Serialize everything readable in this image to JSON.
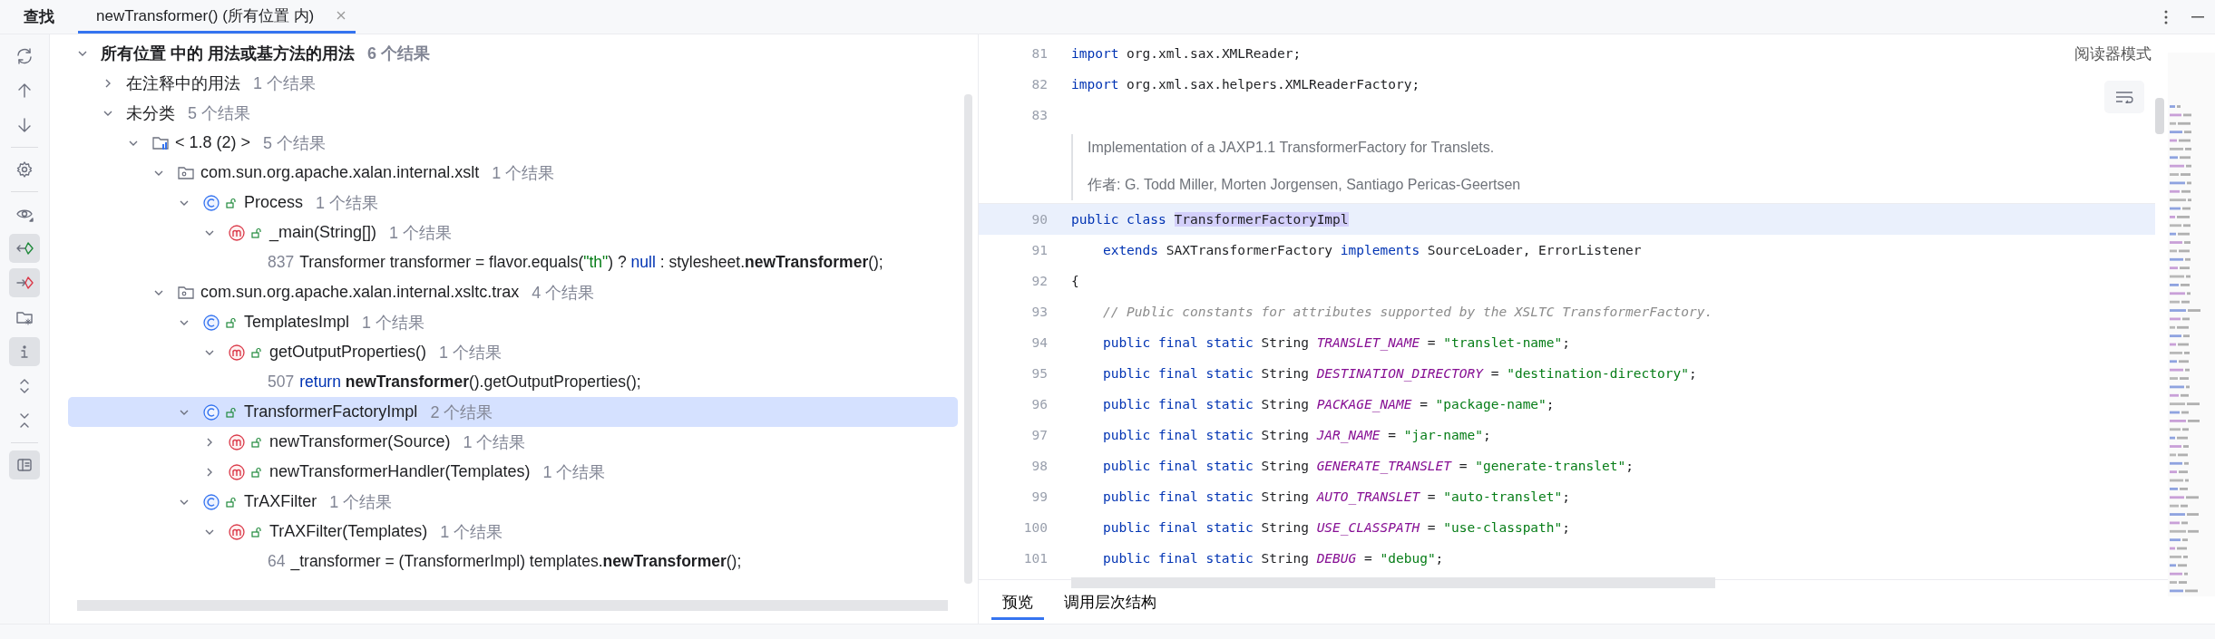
{
  "header": {
    "title": "查找",
    "tabs": [
      {
        "label": "newTransformer() (所有位置 内)",
        "selected": true,
        "closable": true
      }
    ]
  },
  "toolbar": [
    {
      "kind": "refresh",
      "on": false
    },
    {
      "kind": "up",
      "on": false
    },
    {
      "kind": "down",
      "on": false
    },
    {
      "kind": "settings",
      "on": false
    },
    {
      "kind": "eye",
      "on": false
    },
    {
      "kind": "import",
      "on": true
    },
    {
      "kind": "export",
      "on": true
    },
    {
      "kind": "folder",
      "on": false
    },
    {
      "kind": "info",
      "on": true
    },
    {
      "kind": "expand",
      "on": false
    },
    {
      "kind": "collapse",
      "on": false
    },
    {
      "kind": "preview",
      "on": true
    }
  ],
  "tree": {
    "kind": "root",
    "label": "所有位置 中的 用法或基方法的用法",
    "count": "6 个结果",
    "expanded": true,
    "selected": false,
    "children": [
      {
        "kind": "group",
        "label": "在注释中的用法",
        "count": "1 个结果",
        "expanded": false,
        "selected": false
      },
      {
        "kind": "group",
        "label": "未分类",
        "count": "5 个结果",
        "expanded": true,
        "selected": false,
        "children": [
          {
            "kind": "module",
            "label": "< 1.8 (2) >",
            "count": "5 个结果",
            "expanded": true,
            "selected": false,
            "children": [
              {
                "kind": "package",
                "label": "com.sun.org.apache.xalan.internal.xslt",
                "count": "1 个结果",
                "expanded": true,
                "selected": false,
                "children": [
                  {
                    "kind": "class",
                    "label": "Process",
                    "count": "1 个结果",
                    "expanded": true,
                    "selected": false,
                    "children": [
                      {
                        "kind": "method",
                        "label": "_main(String[])",
                        "count": "1 个结果",
                        "expanded": true,
                        "selected": false,
                        "children": [
                          {
                            "kind": "usage",
                            "line": "837",
                            "selected": false,
                            "segments": [
                              {
                                "kind": "plain",
                                "t": "Transformer transformer = flavor.equals("
                              },
                              {
                                "kind": "str",
                                "t": "\"th\""
                              },
                              {
                                "kind": "plain",
                                "t": ") ? "
                              },
                              {
                                "kind": "kw",
                                "t": "null"
                              },
                              {
                                "kind": "plain",
                                "t": " : stylesheet."
                              },
                              {
                                "kind": "bold",
                                "t": "newTransformer"
                              },
                              {
                                "kind": "plain",
                                "t": "();"
                              }
                            ]
                          }
                        ]
                      }
                    ]
                  }
                ]
              },
              {
                "kind": "package",
                "label": "com.sun.org.apache.xalan.internal.xsltc.trax",
                "count": "4 个结果",
                "expanded": true,
                "selected": false,
                "children": [
                  {
                    "kind": "class",
                    "label": "TemplatesImpl",
                    "count": "1 个结果",
                    "expanded": true,
                    "selected": false,
                    "children": [
                      {
                        "kind": "method",
                        "label": "getOutputProperties()",
                        "count": "1 个结果",
                        "expanded": true,
                        "selected": false,
                        "children": [
                          {
                            "kind": "usage",
                            "line": "507",
                            "selected": false,
                            "segments": [
                              {
                                "kind": "kw",
                                "t": "return "
                              },
                              {
                                "kind": "bold",
                                "t": "newTransformer"
                              },
                              {
                                "kind": "plain",
                                "t": "().getOutputProperties();"
                              }
                            ]
                          }
                        ]
                      }
                    ]
                  },
                  {
                    "kind": "class",
                    "label": "TransformerFactoryImpl",
                    "count": "2 个结果",
                    "expanded": true,
                    "selected": true,
                    "children": [
                      {
                        "kind": "method",
                        "label": "newTransformer(Source)",
                        "count": "1 个结果",
                        "expanded": false,
                        "selected": false
                      },
                      {
                        "kind": "method",
                        "label": "newTransformerHandler(Templates)",
                        "count": "1 个结果",
                        "expanded": false,
                        "selected": false
                      }
                    ]
                  },
                  {
                    "kind": "class",
                    "label": "TrAXFilter",
                    "count": "1 个结果",
                    "expanded": true,
                    "selected": false,
                    "children": [
                      {
                        "kind": "method",
                        "label": "TrAXFilter(Templates)",
                        "count": "1 个结果",
                        "expanded": true,
                        "selected": false,
                        "children": [
                          {
                            "kind": "usage",
                            "line": "64",
                            "selected": false,
                            "segments": [
                              {
                                "kind": "plain",
                                "t": "_transformer = (TransformerImpl) templates."
                              },
                              {
                                "kind": "bold",
                                "t": "newTransformer"
                              },
                              {
                                "kind": "plain",
                                "t": "();"
                              }
                            ]
                          }
                        ]
                      }
                    ]
                  }
                ]
              }
            ]
          }
        ]
      }
    ]
  },
  "editor": {
    "reader_mode": "阅读器模式",
    "lines": [
      {
        "kind": "code",
        "no": "81",
        "current": false,
        "segments": [
          {
            "kind": "kw",
            "t": "import"
          },
          {
            "kind": "plain",
            "t": " org.xml.sax.XMLReader;"
          }
        ]
      },
      {
        "kind": "code",
        "no": "82",
        "current": false,
        "segments": [
          {
            "kind": "kw",
            "t": "import"
          },
          {
            "kind": "plain",
            "t": " org.xml.sax.helpers.XMLReaderFactory;"
          }
        ]
      },
      {
        "kind": "code",
        "no": "83",
        "current": false
      },
      {
        "kind": "doc",
        "text": "Implementation of a JAXP1.1 TransformerFactory for Translets.",
        "author": "作者: G. Todd Miller, Morten Jorgensen, Santiago Pericas-Geertsen"
      },
      {
        "kind": "code",
        "no": "90",
        "current": true,
        "segments": [
          {
            "kind": "kw",
            "t": "public class "
          },
          {
            "kind": "mark",
            "t": "TransformerFactoryImpl"
          }
        ]
      },
      {
        "kind": "code",
        "no": "91",
        "current": false,
        "segments": [
          {
            "kind": "kw",
            "t": "    extends"
          },
          {
            "kind": "plain",
            "t": " SAXTransformerFactory "
          },
          {
            "kind": "kw",
            "t": "implements"
          },
          {
            "kind": "plain",
            "t": " SourceLoader, ErrorListener"
          }
        ]
      },
      {
        "kind": "code",
        "no": "92",
        "current": false,
        "segments": [
          {
            "kind": "plain",
            "t": "{"
          }
        ]
      },
      {
        "kind": "code",
        "no": "93",
        "current": false,
        "segments": [
          {
            "kind": "comment",
            "t": "    // Public constants for attributes supported by the XSLTC TransformerFactory."
          }
        ]
      },
      {
        "kind": "code",
        "no": "94",
        "current": false,
        "segments": [
          {
            "kind": "kw",
            "t": "    public final static"
          },
          {
            "kind": "plain",
            "t": " String "
          },
          {
            "kind": "const",
            "t": "TRANSLET_NAME"
          },
          {
            "kind": "plain",
            "t": " = "
          },
          {
            "kind": "str",
            "t": "\"translet-name\""
          },
          {
            "kind": "plain",
            "t": ";"
          }
        ]
      },
      {
        "kind": "code",
        "no": "95",
        "current": false,
        "segments": [
          {
            "kind": "kw",
            "t": "    public final static"
          },
          {
            "kind": "plain",
            "t": " String "
          },
          {
            "kind": "const",
            "t": "DESTINATION_DIRECTORY"
          },
          {
            "kind": "plain",
            "t": " = "
          },
          {
            "kind": "str",
            "t": "\"destination-directory\""
          },
          {
            "kind": "plain",
            "t": ";"
          }
        ]
      },
      {
        "kind": "code",
        "no": "96",
        "current": false,
        "segments": [
          {
            "kind": "kw",
            "t": "    public final static"
          },
          {
            "kind": "plain",
            "t": " String "
          },
          {
            "kind": "const",
            "t": "PACKAGE_NAME"
          },
          {
            "kind": "plain",
            "t": " = "
          },
          {
            "kind": "str",
            "t": "\"package-name\""
          },
          {
            "kind": "plain",
            "t": ";"
          }
        ]
      },
      {
        "kind": "code",
        "no": "97",
        "current": false,
        "segments": [
          {
            "kind": "kw",
            "t": "    public final static"
          },
          {
            "kind": "plain",
            "t": " String "
          },
          {
            "kind": "const",
            "t": "JAR_NAME"
          },
          {
            "kind": "plain",
            "t": " = "
          },
          {
            "kind": "str",
            "t": "\"jar-name\""
          },
          {
            "kind": "plain",
            "t": ";"
          }
        ]
      },
      {
        "kind": "code",
        "no": "98",
        "current": false,
        "segments": [
          {
            "kind": "kw",
            "t": "    public final static"
          },
          {
            "kind": "plain",
            "t": " String "
          },
          {
            "kind": "const",
            "t": "GENERATE_TRANSLET"
          },
          {
            "kind": "plain",
            "t": " = "
          },
          {
            "kind": "str",
            "t": "\"generate-translet\""
          },
          {
            "kind": "plain",
            "t": ";"
          }
        ]
      },
      {
        "kind": "code",
        "no": "99",
        "current": false,
        "segments": [
          {
            "kind": "kw",
            "t": "    public final static"
          },
          {
            "kind": "plain",
            "t": " String "
          },
          {
            "kind": "const",
            "t": "AUTO_TRANSLET"
          },
          {
            "kind": "plain",
            "t": " = "
          },
          {
            "kind": "str",
            "t": "\"auto-translet\""
          },
          {
            "kind": "plain",
            "t": ";"
          }
        ]
      },
      {
        "kind": "code",
        "no": "100",
        "current": false,
        "segments": [
          {
            "kind": "kw",
            "t": "    public final static"
          },
          {
            "kind": "plain",
            "t": " String "
          },
          {
            "kind": "const",
            "t": "USE_CLASSPATH"
          },
          {
            "kind": "plain",
            "t": " = "
          },
          {
            "kind": "str",
            "t": "\"use-classpath\""
          },
          {
            "kind": "plain",
            "t": ";"
          }
        ]
      },
      {
        "kind": "code",
        "no": "101",
        "current": false,
        "segments": [
          {
            "kind": "kw",
            "t": "    public final static"
          },
          {
            "kind": "plain",
            "t": " String "
          },
          {
            "kind": "const",
            "t": "DEBUG"
          },
          {
            "kind": "plain",
            "t": " = "
          },
          {
            "kind": "str",
            "t": "\"debug\""
          },
          {
            "kind": "plain",
            "t": ";"
          }
        ]
      }
    ]
  },
  "bottom_tabs": [
    {
      "label": "预览",
      "selected": true
    },
    {
      "label": "调用层次结构",
      "selected": false
    }
  ]
}
